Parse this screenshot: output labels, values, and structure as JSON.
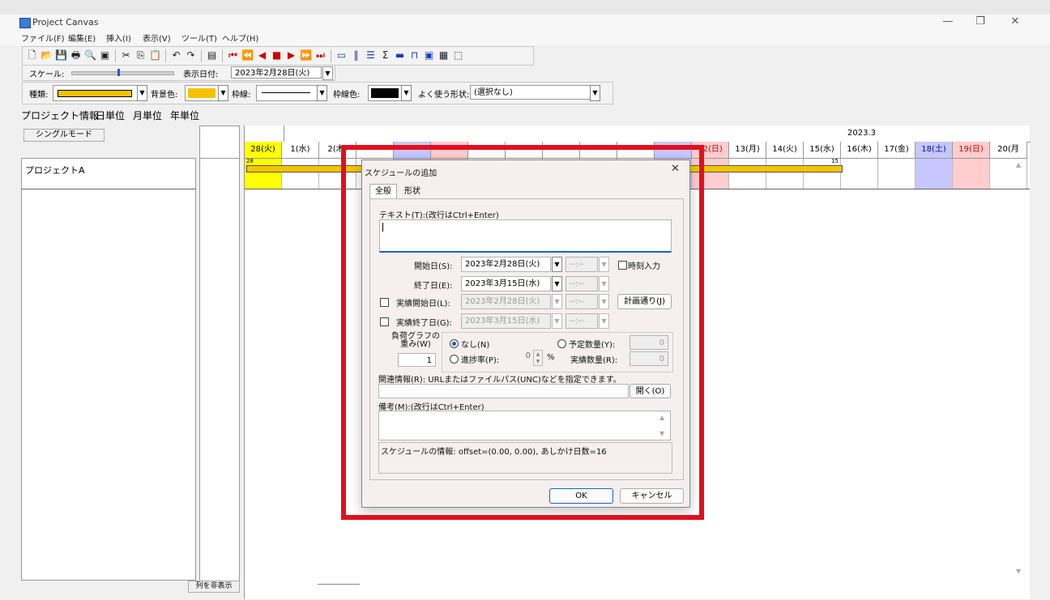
{
  "app": {
    "title": "Project Canvas",
    "window_controls": [
      "—",
      "❐",
      "✕"
    ]
  },
  "menu": [
    "ファイル(F)",
    "編集(E)",
    "挿入(I)",
    "表示(V)",
    "ツール(T)",
    "ヘルプ(H)"
  ],
  "toolbar2": {
    "scale_label": "スケール:",
    "date_label": "表示日付:",
    "date_value": "2023年2月28日(火)"
  },
  "toolbar3": {
    "type_label": "種類:",
    "bg_label": "背景色:",
    "line_label": "枠線:",
    "linecolor_label": "枠線色:",
    "shape_label": "よく使う形状:",
    "shape_value": "(選択なし)",
    "bar_color": "#f4c400",
    "bg_color": "#f6c000",
    "linecolor_color": "#000000"
  },
  "view_tabs": [
    "プロジェクト情報",
    "日単位",
    "月単位",
    "年単位"
  ],
  "panel": {
    "mode_button": "シングルモード",
    "project_name": "プロジェクトA",
    "hide_columns": "列を非表示"
  },
  "gantt": {
    "month_label": "2023.3",
    "days": [
      {
        "label": "28(火)",
        "bg": "#ffff00",
        "color": "#000000"
      },
      {
        "label": "1(水)",
        "bg": "#ffffff",
        "color": "#000000"
      },
      {
        "label": "2(木)",
        "bg": "#ffffff",
        "color": "#000000"
      },
      {
        "label": "",
        "bg": "#ffffff",
        "color": "#000000"
      },
      {
        "label": "",
        "bg": "#c7c7ff",
        "color": "#000000"
      },
      {
        "label": "",
        "bg": "#ffcdcd",
        "color": "#000000"
      },
      {
        "label": "",
        "bg": "#ffffff",
        "color": "#000000"
      },
      {
        "label": "",
        "bg": "#ffffff",
        "color": "#000000"
      },
      {
        "label": "",
        "bg": "#ffffff",
        "color": "#000000"
      },
      {
        "label": "",
        "bg": "#ffffff",
        "color": "#000000"
      },
      {
        "label": "",
        "bg": "#ffffff",
        "color": "#000000"
      },
      {
        "label": "",
        "bg": "#c7c7ff",
        "color": "#000000"
      },
      {
        "label": "12(日)",
        "bg": "#ffcdcd",
        "color": "#d00000"
      },
      {
        "label": "13(月)",
        "bg": "#ffffff",
        "color": "#000000"
      },
      {
        "label": "14(火)",
        "bg": "#ffffff",
        "color": "#000000"
      },
      {
        "label": "15(水)",
        "bg": "#ffffff",
        "color": "#000000"
      },
      {
        "label": "16(木)",
        "bg": "#ffffff",
        "color": "#000000"
      },
      {
        "label": "17(金)",
        "bg": "#ffffff",
        "color": "#000000"
      },
      {
        "label": "18(土)",
        "bg": "#c7c7ff",
        "color": "#0000c0"
      },
      {
        "label": "19(日)",
        "bg": "#ffcdcd",
        "color": "#d00000"
      },
      {
        "label": "20(月",
        "bg": "#ffffff",
        "color": "#000000"
      }
    ],
    "bar_start_label": "28",
    "bar_end_label": "15"
  },
  "dialog": {
    "title": "スケジュールの追加",
    "tabs": [
      "全般",
      "形状"
    ],
    "text_label": "テキスト(T):(改行はCtrl+Enter)",
    "text_value": "",
    "start_label": "開始日(S):",
    "start_value": "2023年2月28日(火)",
    "start_time": "--:--",
    "time_input_label": "時刻入力",
    "end_label": "終了日(E):",
    "end_value": "2023年3月15日(水)",
    "end_time": "--:--",
    "actual_start_label": "実績開始日(L):",
    "actual_start_value": "2023年2月28日(火)",
    "actual_start_time": "--:--",
    "plan_button": "計画通り(J)",
    "actual_end_label": "実績終了日(G):",
    "actual_end_value": "2023年3月15日(水)",
    "actual_end_time": "--:--",
    "load_weight_label_1": "負荷グラフの",
    "load_weight_label_2": "重み(W)",
    "load_weight_value": "1",
    "none_option": "なし(N)",
    "progress_option": "進捗率(P):",
    "progress_value": "0",
    "progress_unit": "%",
    "planned_qty_option": "予定数量(Y):",
    "planned_qty_value": "0",
    "actual_qty_label": "実績数量(R):",
    "actual_qty_value": "0",
    "related_label": "関連情報(R): URLまたはファイルパス(UNC)などを指定できます。",
    "related_value": "",
    "open_button": "開く(O)",
    "notes_label": "備考(M):(改行はCtrl+Enter)",
    "notes_value": "",
    "info_text": "スケジュールの情報: offset=(0.00, 0.00), あしかけ日数=16",
    "ok_button": "OK",
    "cancel_button": "キャンセル",
    "highlight_color": "#e0101e"
  }
}
